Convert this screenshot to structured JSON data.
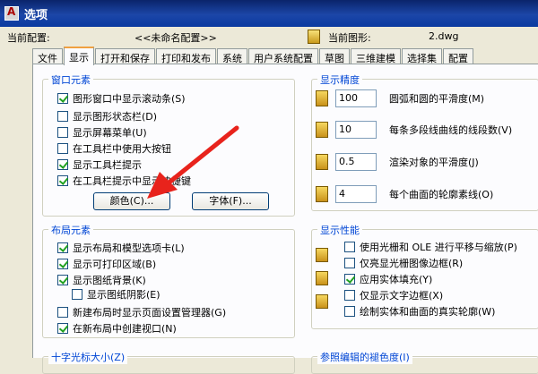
{
  "window": {
    "title": "选项"
  },
  "config": {
    "current_profile_label": "当前配置:",
    "current_profile_value": "<<未命名配置>>",
    "current_drawing_label": "当前图形:",
    "current_drawing_value": "2.dwg"
  },
  "tabs": [
    {
      "label": "文件",
      "active": false
    },
    {
      "label": "显示",
      "active": true
    },
    {
      "label": "打开和保存",
      "active": false
    },
    {
      "label": "打印和发布",
      "active": false
    },
    {
      "label": "系统",
      "active": false
    },
    {
      "label": "用户系统配置",
      "active": false
    },
    {
      "label": "草图",
      "active": false
    },
    {
      "label": "三维建模",
      "active": false
    },
    {
      "label": "选择集",
      "active": false
    },
    {
      "label": "配置",
      "active": false
    }
  ],
  "window_elements": {
    "title": "窗口元素",
    "items": [
      {
        "label": "图形窗口中显示滚动条(S)",
        "checked": true
      },
      {
        "label": "显示图形状态栏(D)",
        "checked": false
      },
      {
        "label": "显示屏幕菜单(U)",
        "checked": false
      },
      {
        "label": "在工具栏中使用大按钮",
        "checked": false
      },
      {
        "label": "显示工具栏提示",
        "checked": true
      },
      {
        "label": "在工具栏提示中显示快捷键",
        "checked": true
      }
    ],
    "colors_button": "颜色(C)...",
    "fonts_button": "字体(F)..."
  },
  "layout_elements": {
    "title": "布局元素",
    "items": [
      {
        "label": "显示布局和模型选项卡(L)",
        "checked": true
      },
      {
        "label": "显示可打印区域(B)",
        "checked": true
      },
      {
        "label": "显示图纸背景(K)",
        "checked": true
      },
      {
        "label": "显示图纸阴影(E)",
        "checked": false
      },
      {
        "label": "新建布局时显示页面设置管理器(G)",
        "checked": false
      },
      {
        "label": "在新布局中创建视口(N)",
        "checked": true
      }
    ]
  },
  "display_resolution": {
    "title": "显示精度",
    "items": [
      {
        "value": "100",
        "label": "圆弧和圆的平滑度(M)"
      },
      {
        "value": "10",
        "label": "每条多段线曲线的线段数(V)"
      },
      {
        "value": "0.5",
        "label": "渲染对象的平滑度(J)"
      },
      {
        "value": "4",
        "label": "每个曲面的轮廓素线(O)"
      }
    ]
  },
  "display_performance": {
    "title": "显示性能",
    "items": [
      {
        "label": "使用光栅和 OLE 进行平移与缩放(P)",
        "checked": false
      },
      {
        "label": "仅亮显光栅图像边框(R)",
        "checked": false
      },
      {
        "label": "应用实体填充(Y)",
        "checked": true
      },
      {
        "label": "仅显示文字边框(X)",
        "checked": false
      },
      {
        "label": "绘制实体和曲面的真实轮廓(W)",
        "checked": false
      }
    ]
  },
  "bottom_groups": {
    "crosshair_title": "十字光标大小(Z)",
    "xref_fade_title": "参照编辑的褪色度(I)"
  },
  "colors": {
    "accent": "#0046d5",
    "annotation_arrow": "#e8231c",
    "check": "#21a121"
  }
}
